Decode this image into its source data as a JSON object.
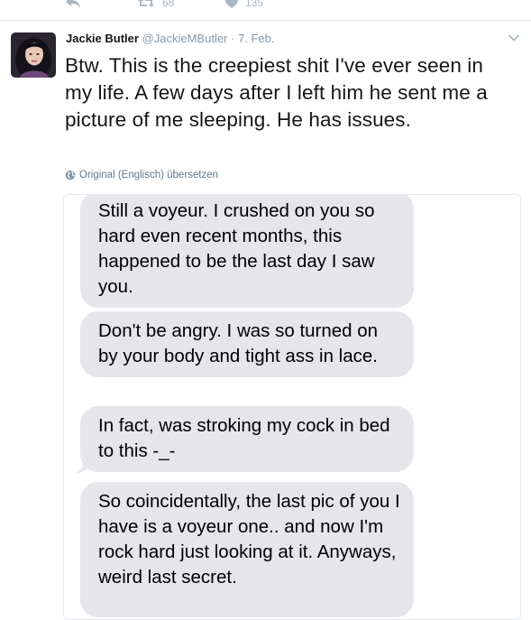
{
  "actions": {
    "retweet_count": "68",
    "like_count": "135"
  },
  "tweet": {
    "name": "Jackie Butler",
    "handle": "@JackieMButler",
    "separator": "·",
    "date": "7. Feb.",
    "text": "Btw. This is the creepiest shit I've ever seen in my life. A few days after I left him he sent me a picture of me sleeping. He has issues.",
    "translate_label": "Original (Englisch) übersetzen"
  },
  "messages": [
    "Still a voyeur. I crushed on you so hard even recent months, this happened to be the last day I saw you.",
    "Don't be angry. I was so turned on by your body and tight ass in lace.",
    "In fact, was stroking my cock in bed to this -_-",
    "So coincidentally, the last pic of you I have is a voyeur one.. and now I'm rock hard just looking at it. Anyways, weird last secret."
  ],
  "colors": {
    "bubble": "#e5e5ea",
    "icon": "#aab8c2",
    "meta": "#8899a6"
  },
  "icons": {
    "reply": "reply-icon",
    "retweet": "retweet-icon",
    "like": "heart-icon",
    "more": "chevron-down-icon",
    "globe": "globe-icon"
  }
}
